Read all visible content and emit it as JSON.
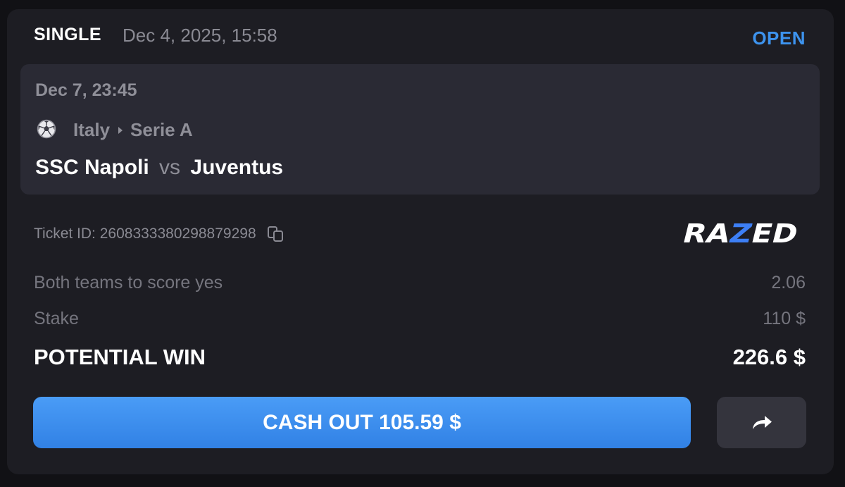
{
  "ticket": {
    "type": "SINGLE",
    "placed_at": "Dec 4, 2025, 15:58",
    "status": "OPEN",
    "status_color": "#3d93ee"
  },
  "event": {
    "date": "Dec 7, 23:45",
    "sport_icon": "soccer-ball-icon",
    "country": "Italy",
    "league": "Serie A",
    "home_team": "SSC Napoli",
    "vs": "vs",
    "away_team": "Juventus"
  },
  "ticket_id": {
    "label": "Ticket ID: 2608333380298879298",
    "icon": "copy-icon"
  },
  "brand": {
    "logo_text": "RAZED",
    "accent_color": "#3d7ff5"
  },
  "bet": {
    "selection": "Both teams to score yes",
    "odds": "2.06",
    "stake_label": "Stake",
    "stake_value": "110 $",
    "win_label": "POTENTIAL WIN",
    "win_value": "226.6 $"
  },
  "actions": {
    "cashout_label": "CASH OUT 105.59 $",
    "cashout_color": "#3d8af0",
    "share_icon": "share-arrow-icon"
  }
}
